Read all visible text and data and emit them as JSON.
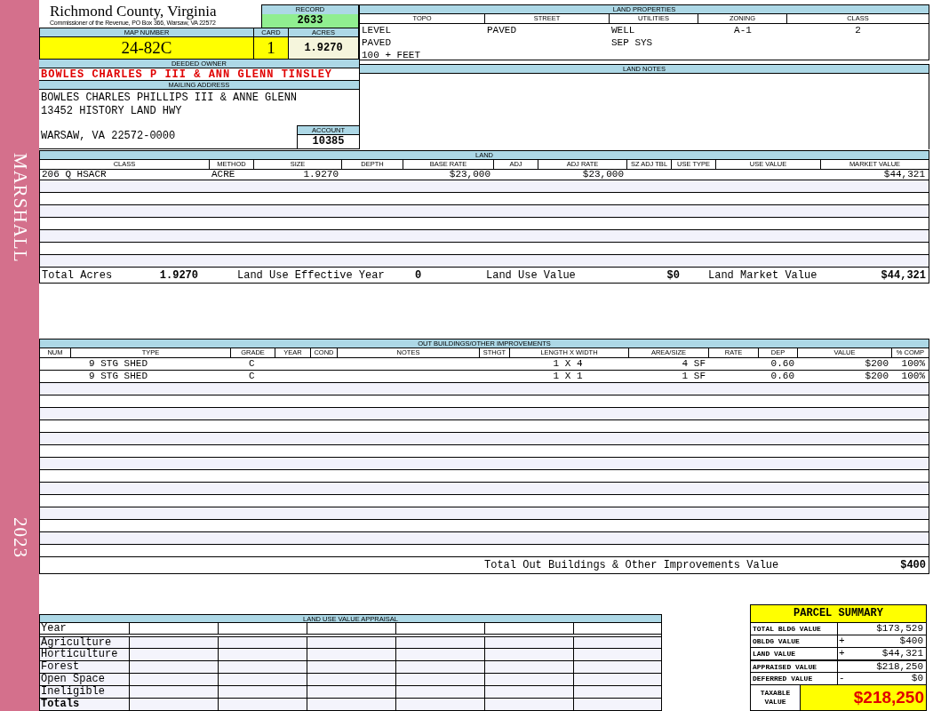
{
  "sidebar": {
    "name": "MARSHALL",
    "year": "2023"
  },
  "header": {
    "title": "Richmond County, Virginia",
    "subtitle": "Commissioner of the Revenue, PO Box 366, Warsaw, VA 22572"
  },
  "record": {
    "label": "RECORD",
    "value": "2633"
  },
  "map_number": {
    "label": "MAP NUMBER",
    "value": "24-82C"
  },
  "card": {
    "label": "CARD",
    "value": "1"
  },
  "acres": {
    "label": "ACRES",
    "value": "1.9270"
  },
  "deeded_owner": {
    "label": "DEEDED OWNER",
    "value": "BOWLES CHARLES P III & ANN GLENN TINSLEY"
  },
  "mailing_address": {
    "label": "MAILING ADDRESS",
    "lines": [
      "BOWLES CHARLES PHILLIPS III & ANNE GLENN",
      "13452 HISTORY LAND HWY"
    ],
    "city_line": "WARSAW, VA 22572-0000"
  },
  "account": {
    "label": "ACCOUNT",
    "value": "10385"
  },
  "land_properties": {
    "title": "LAND PROPERTIES",
    "columns": [
      {
        "label": "TOPO",
        "values": [
          "LEVEL",
          "PAVED",
          "100 + FEET"
        ]
      },
      {
        "label": "STREET",
        "values": [
          "PAVED"
        ]
      },
      {
        "label": "UTILITIES",
        "values": [
          "WELL",
          "SEP SYS"
        ]
      },
      {
        "label": "ZONING",
        "values": [
          "A-1"
        ]
      },
      {
        "label": "CLASS",
        "values": [
          "2"
        ]
      }
    ]
  },
  "land_notes": {
    "title": "LAND NOTES"
  },
  "land": {
    "title": "LAND",
    "columns": [
      "CLASS",
      "METHOD",
      "SIZE",
      "DEPTH",
      "BASE RATE",
      "ADJ",
      "ADJ RATE",
      "SZ ADJ TBL",
      "USE TYPE",
      "USE VALUE",
      "MARKET VALUE"
    ],
    "rows": [
      [
        "206 Q HSACR",
        "ACRE",
        "1.9270",
        null,
        "$23,000",
        null,
        "$23,000",
        null,
        null,
        null,
        "$44,321"
      ]
    ],
    "totals": [
      {
        "label": "Total Acres",
        "value": "1.9270"
      },
      {
        "label": "Land Use Effective Year",
        "value": "0"
      },
      {
        "label": "Land Use Value",
        "value": "$0"
      },
      {
        "label": "Land Market Value",
        "value": "$44,321"
      }
    ]
  },
  "outbuildings": {
    "title": "OUT BUILDINGS/OTHER IMPROVEMENTS",
    "columns": [
      "NUM",
      "TYPE",
      "GRADE",
      "YEAR",
      "COND",
      "NOTES",
      "STHGT",
      "LENGTH X WIDTH",
      "AREA/SIZE",
      "RATE",
      "DEP",
      "VALUE",
      "% COMP"
    ],
    "rows": [
      [
        null,
        "9 STG SHED",
        "C",
        null,
        null,
        null,
        null,
        "1 X 4",
        "4 SF",
        null,
        "0.60",
        "$200",
        "100%"
      ],
      [
        null,
        "9 STG SHED",
        "C",
        null,
        null,
        null,
        null,
        "1 X 1",
        "1 SF",
        null,
        "0.60",
        "$200",
        "100%"
      ]
    ],
    "total": {
      "label": "Total Out Buildings & Other Improvements Value",
      "value": "$400"
    }
  },
  "land_use_appraisal": {
    "title": "LAND USE VALUE APPRAISAL",
    "year_label": "Year",
    "rows": [
      "Agriculture",
      "Horticulture",
      "Forest",
      "Open Space",
      "Ineligible"
    ],
    "total_label": "Totals"
  },
  "parcel_summary": {
    "title": "PARCEL SUMMARY",
    "rows": [
      {
        "label": "TOTAL BLDG VALUE",
        "value": "$173,529"
      },
      {
        "label": "OBLDG VALUE",
        "sign": "+",
        "value": "$400"
      },
      {
        "label": "LAND VALUE",
        "sign": "+",
        "value": "$44,321"
      },
      {
        "label": "APPRAISED VALUE",
        "value": "$218,250"
      },
      {
        "label": "DEFERRED VALUE",
        "sign": "-",
        "value": "$0"
      }
    ],
    "taxable": {
      "label": "TAXABLE VALUE",
      "value": "$218,250"
    }
  }
}
